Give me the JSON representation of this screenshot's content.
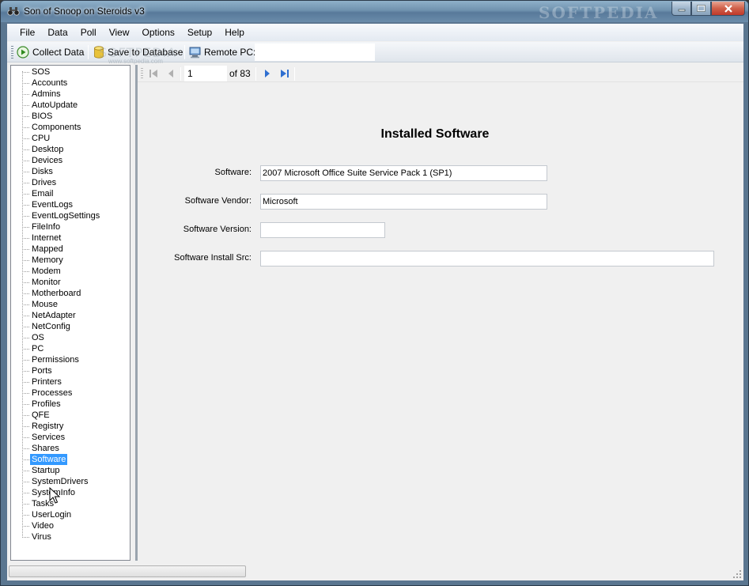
{
  "window": {
    "title": "Son of Snoop on Steroids v3",
    "watermark": "SOFTPEDIA"
  },
  "menu": [
    "File",
    "Data",
    "Poll",
    "View",
    "Options",
    "Setup",
    "Help"
  ],
  "toolbar": {
    "collect_label": "Collect Data",
    "save_label": "Save to Database",
    "remote_label": "Remote PC:",
    "remote_value": "",
    "watermark": "SOFTPEDIA",
    "watermark_url": "www.softpedia.com"
  },
  "tree": {
    "selected": "Software",
    "items": [
      "SOS",
      "Accounts",
      "Admins",
      "AutoUpdate",
      "BIOS",
      "Components",
      "CPU",
      "Desktop",
      "Devices",
      "Disks",
      "Drives",
      "Email",
      "EventLogs",
      "EventLogSettings",
      "FileInfo",
      "Internet",
      "Mapped",
      "Memory",
      "Modem",
      "Monitor",
      "Motherboard",
      "Mouse",
      "NetAdapter",
      "NetConfig",
      "OS",
      "PC",
      "Permissions",
      "Ports",
      "Printers",
      "Processes",
      "Profiles",
      "QFE",
      "Registry",
      "Services",
      "Shares",
      "Software",
      "Startup",
      "SystemDrivers",
      "SystemInfo",
      "Tasks",
      "UserLogin",
      "Video",
      "Virus"
    ]
  },
  "navigator": {
    "position": "1",
    "count_label": "of 83"
  },
  "panel": {
    "title": "Installed Software",
    "fields": [
      {
        "label": "Software:",
        "value": "2007 Microsoft Office Suite Service Pack 1 (SP1)"
      },
      {
        "label": "Software Vendor:",
        "value": "Microsoft"
      },
      {
        "label": "Software Version:",
        "value": ""
      },
      {
        "label": "Software Install Src:",
        "value": ""
      }
    ]
  },
  "colors": {
    "selection": "#3399ff",
    "title_bar": "#6f92af",
    "close_button": "#d0614a"
  }
}
